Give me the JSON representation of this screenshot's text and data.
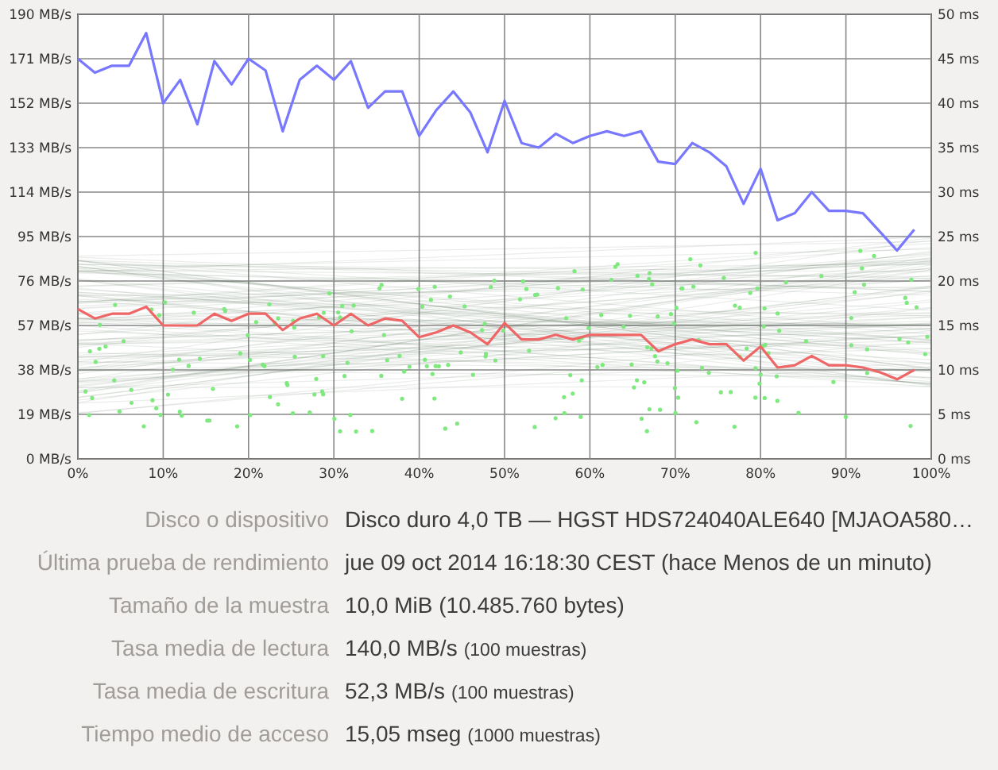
{
  "benchmark_chart": {
    "chart_data": {
      "type": "line",
      "grid": true,
      "xlim": [
        0,
        100
      ],
      "ylim": [
        0,
        190
      ],
      "xticks": [
        {
          "value": 0,
          "label": "0%"
        },
        {
          "value": 10,
          "label": "10%"
        },
        {
          "value": 20,
          "label": "20%"
        },
        {
          "value": 30,
          "label": "30%"
        },
        {
          "value": 40,
          "label": "40%"
        },
        {
          "value": 50,
          "label": "50%"
        },
        {
          "value": 60,
          "label": "60%"
        },
        {
          "value": 70,
          "label": "70%"
        },
        {
          "value": 80,
          "label": "80%"
        },
        {
          "value": 90,
          "label": "90%"
        },
        {
          "value": 100,
          "label": "100%"
        }
      ],
      "yticks": [
        {
          "value": 0,
          "label": "0 MB/s"
        },
        {
          "value": 19,
          "label": "19 MB/s"
        },
        {
          "value": 38,
          "label": "38 MB/s"
        },
        {
          "value": 57,
          "label": "57 MB/s"
        },
        {
          "value": 76,
          "label": "76 MB/s"
        },
        {
          "value": 95,
          "label": "95 MB/s"
        },
        {
          "value": 114,
          "label": "114 MB/s"
        },
        {
          "value": 133,
          "label": "133 MB/s"
        },
        {
          "value": 152,
          "label": "152 MB/s"
        },
        {
          "value": 171,
          "label": "171 MB/s"
        },
        {
          "value": 190,
          "label": "190 MB/s"
        }
      ],
      "x": [
        0,
        2,
        4,
        6,
        8,
        10,
        12,
        14,
        16,
        18,
        20,
        22,
        24,
        26,
        28,
        30,
        32,
        34,
        36,
        38,
        40,
        42,
        44,
        46,
        48,
        50,
        52,
        54,
        56,
        58,
        60,
        62,
        64,
        66,
        68,
        70,
        72,
        74,
        76,
        78,
        80,
        82,
        84,
        86,
        88,
        90,
        92,
        94,
        96,
        98
      ],
      "series": [
        {
          "color": "#7777ff",
          "values": [
            171,
            165,
            168,
            168,
            182,
            152,
            162,
            143,
            170,
            160,
            171,
            166,
            140,
            162,
            168,
            162,
            170,
            150,
            157,
            157,
            138,
            149,
            157,
            148,
            131,
            153,
            135,
            133,
            139,
            135,
            138,
            140,
            138,
            140,
            127,
            126,
            135,
            131,
            125,
            109,
            124,
            102,
            105,
            114,
            106,
            106,
            105,
            97,
            89,
            98
          ]
        },
        {
          "color": "#ee6666",
          "values": [
            64,
            60,
            62,
            62,
            65,
            57,
            57,
            57,
            62,
            59,
            62,
            62,
            55,
            60,
            62,
            57,
            62,
            57,
            60,
            59,
            52,
            54,
            57,
            54,
            49,
            58,
            51,
            51,
            53,
            51,
            53,
            53,
            53,
            53,
            46,
            49,
            51,
            49,
            49,
            42,
            48,
            39,
            40,
            44,
            40,
            40,
            39,
            37,
            34,
            38
          ]
        }
      ]
    },
    "right_axis_labels": [
      "50 ms",
      "45 ms",
      "40 ms",
      "35 ms",
      "30 ms",
      "25 ms",
      "20 ms",
      "15 ms",
      "10 ms",
      "5 ms",
      "0 ms"
    ]
  },
  "details": [
    {
      "label": "Disco o dispositivo",
      "value": "Disco duro 4,0 TB — HGST HDS724040ALE640 [MJAOA580…"
    },
    {
      "label": "Última prueba de rendimiento",
      "value": "jue 09 oct 2014 16:18:30 CEST (hace Menos de un minuto)"
    },
    {
      "label": "Tamaño de la muestra",
      "value": "10,0 MiB (10.485.760 bytes)"
    },
    {
      "label": "Tasa media de lectura",
      "value": "140,0 MB/s",
      "note": "(100 muestras)"
    },
    {
      "label": "Tasa media de escritura",
      "value": "52,3 MB/s",
      "note": "(100 muestras)"
    },
    {
      "label": "Tiempo medio de acceso",
      "value": "15,05 mseg",
      "note": "(1000 muestras)"
    }
  ]
}
